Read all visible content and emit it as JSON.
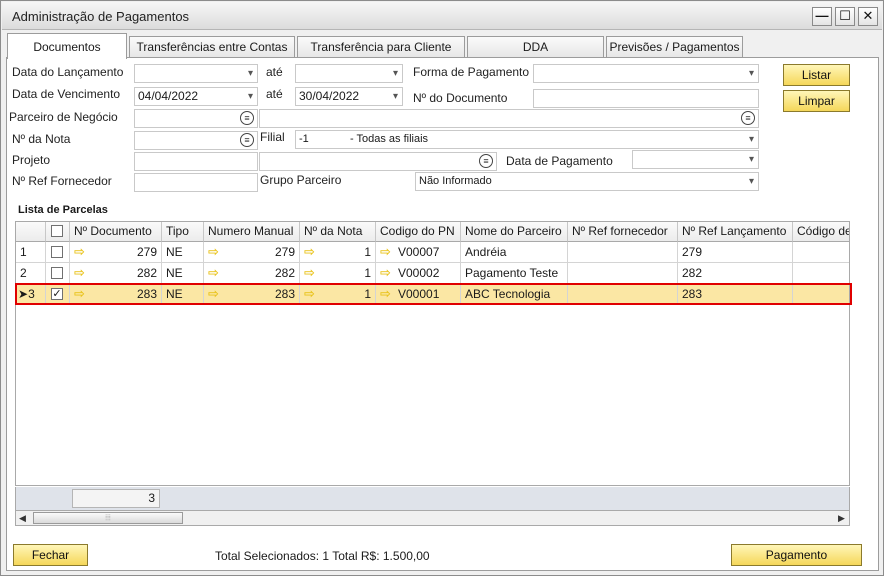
{
  "window": {
    "title": "Administração de Pagamentos",
    "min_label": "—",
    "max_label": "☐",
    "close_label": "✕"
  },
  "tabs": [
    {
      "label": "Documentos"
    },
    {
      "label": "Transferências entre Contas"
    },
    {
      "label": "Transferência para Cliente"
    },
    {
      "label": "DDA"
    },
    {
      "label": "Previsões / Pagamentos"
    }
  ],
  "filters": {
    "data_lancamento": {
      "label": "Data do Lançamento",
      "value": "",
      "ate_label": "até",
      "ate_value": ""
    },
    "data_vencimento": {
      "label": "Data de Vencimento",
      "value": "04/04/2022",
      "ate_label": "até",
      "ate_value": "30/04/2022"
    },
    "forma_pagamento": {
      "label": "Forma de Pagamento",
      "value": ""
    },
    "num_documento": {
      "label": "Nº do Documento",
      "value": ""
    },
    "parceiro": {
      "label": "Parceiro de Negócio",
      "value": "",
      "value2": ""
    },
    "num_nota": {
      "label": "Nº da Nota",
      "value": ""
    },
    "filial": {
      "label": "Filial",
      "code": "-1",
      "value": "- Todas as filiais"
    },
    "projeto": {
      "label": "Projeto",
      "value": "",
      "value2": ""
    },
    "data_pagamento": {
      "label": "Data de Pagamento",
      "value": ""
    },
    "ref_fornecedor": {
      "label": "Nº Ref Fornecedor",
      "value": ""
    },
    "grupo_parceiro": {
      "label": "Grupo Parceiro",
      "value": "Não Informado"
    }
  },
  "buttons": {
    "listar": "Listar",
    "limpar": "Limpar",
    "fechar": "Fechar",
    "pagamento": "Pagamento"
  },
  "grid": {
    "title": "Lista de Parcelas",
    "columns": [
      "",
      "",
      "Nº Documento",
      "Tipo",
      "Numero Manual",
      "Nº da Nota",
      "Codigo do PN",
      "Nome do Parceiro",
      "Nº Ref fornecedor",
      "Nº Ref Lançamento",
      "Código de B"
    ],
    "rows": [
      {
        "n": "1",
        "checked": false,
        "doc": "279",
        "tipo": "NE",
        "manual": "279",
        "nota": "1",
        "pn": "V00007",
        "nome": "Andréia",
        "ref_forn": "",
        "ref_lanc": "279",
        "cod_b": "",
        "selected": false
      },
      {
        "n": "2",
        "checked": false,
        "doc": "282",
        "tipo": "NE",
        "manual": "282",
        "nota": "1",
        "pn": "V00002",
        "nome": "Pagamento Teste",
        "ref_forn": "",
        "ref_lanc": "282",
        "cod_b": "",
        "selected": false
      },
      {
        "n": "3",
        "checked": true,
        "doc": "283",
        "tipo": "NE",
        "manual": "283",
        "nota": "1",
        "pn": "V00001",
        "nome": "ABC Tecnologia",
        "ref_forn": "",
        "ref_lanc": "283",
        "cod_b": "",
        "selected": true
      }
    ],
    "total_documentos": "3"
  },
  "status": "Total Selecionados: 1 Total R$: 1.500,00",
  "colors": {
    "selected_row": "#fbe7a4",
    "highlight_border": "#e00000",
    "button_gradient_top": "#fff6b8",
    "button_gradient_bottom": "#f5d75a",
    "link_arrow": "#e9c31b"
  }
}
